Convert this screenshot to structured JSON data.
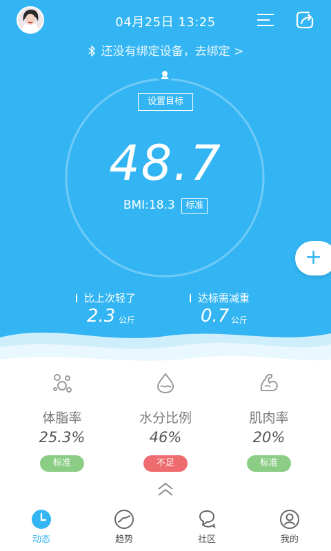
{
  "header": {
    "date_time": "04月25日 13:25",
    "bind_prompt": "还没有绑定设备，去绑定 >"
  },
  "dashboard": {
    "set_goal": "设置目标",
    "weight": "48.7",
    "bmi_text": "BMI:18.3",
    "bmi_status": "标准",
    "stats": [
      {
        "label": "比上次轻了",
        "value": "2.3",
        "unit": "公斤"
      },
      {
        "label": "达标需减重",
        "value": "0.7",
        "unit": "公斤"
      }
    ]
  },
  "metrics": [
    {
      "name": "体脂率",
      "value": "25.3%",
      "status": "标准",
      "status_color": "#8ccd86",
      "icon": "body-fat-icon"
    },
    {
      "name": "水分比例",
      "value": "46%",
      "status": "不足",
      "status_color": "#ee6b6f",
      "icon": "water-drop-icon"
    },
    {
      "name": "肌肉率",
      "value": "20%",
      "status": "标准",
      "status_color": "#8ccd86",
      "icon": "muscle-arm-icon"
    }
  ],
  "tabs": [
    {
      "label": "动态",
      "icon": "clock-icon",
      "active": true
    },
    {
      "label": "趋势",
      "icon": "trend-icon",
      "active": false
    },
    {
      "label": "社区",
      "icon": "community-icon",
      "active": false
    },
    {
      "label": "我的",
      "icon": "user-icon",
      "active": false
    }
  ],
  "colors": {
    "primary": "#33b5f3",
    "ok": "#8ccd86",
    "warning": "#ee6b6f"
  }
}
